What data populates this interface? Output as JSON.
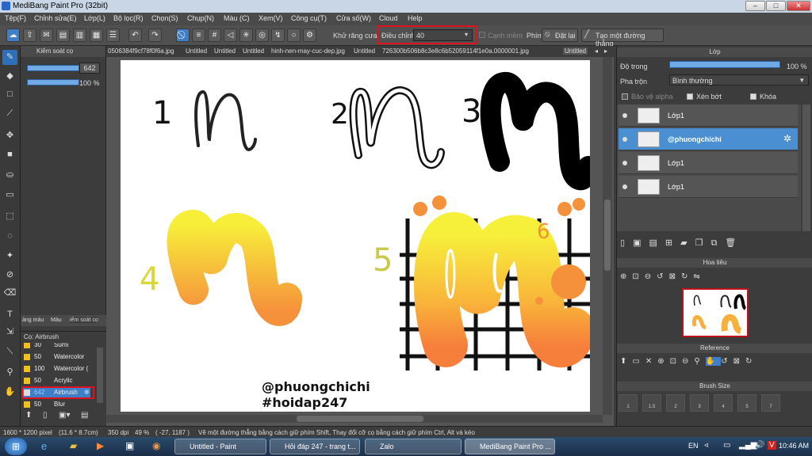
{
  "window": {
    "title": "MediBang Paint Pro (32bit)",
    "btn_min": "‒",
    "btn_max": "□",
    "btn_close": "✕"
  },
  "menu": [
    "Tệp(F)",
    "Chỉnh sửa(E)",
    "Lớp(L)",
    "Bộ lọc(R)",
    "Chọn(S)",
    "Chụp(N)",
    "Màu (C)",
    "Xem(V)",
    "Công cụ(T)",
    "Cửa số(W)",
    "Cloud",
    "Help"
  ],
  "toolbar": {
    "antialias_label": "Khử răng cưa",
    "adjust_label": "Điều chỉnh",
    "adjust_value": "40",
    "edge_label": "Cạnh mềm",
    "key_label": "Phím",
    "reset_label": "Đặt lại",
    "straight_label": "Tạo một đường thẳng"
  },
  "brush_control": {
    "title": "Kiểm soát cọ",
    "size_value": "642",
    "opacity_value": "100 %",
    "size_fraction": 0.62,
    "opacity_fraction": 1.0
  },
  "tabs_left": {
    "a": "ảng màu",
    "b": "Màu",
    "c": "iểm soát cọ"
  },
  "brush_list": {
    "title": "Cọ: Airbrush",
    "items": [
      {
        "size": "30",
        "name": "Sumi",
        "color": "#f0c020"
      },
      {
        "size": "50",
        "name": "Watercolor",
        "color": "#f0c020"
      },
      {
        "size": "100",
        "name": "Watercolor (",
        "color": "#f0c020"
      },
      {
        "size": "50",
        "name": "Acrylic",
        "color": "#f0c020"
      },
      {
        "size": "642",
        "name": "Airbrush",
        "color": "#dddddd"
      },
      {
        "size": "50",
        "name": "Blur",
        "color": "#f0c020"
      }
    ]
  },
  "doc_tabs": [
    "0506384f9cf78f0f6a.jpg",
    "Untitled",
    "Untitled",
    "Untitled",
    "hinh-nen-may-cuc-dep.jpg",
    "Untitled",
    "726300b506b8c3e8c6b52059114f1e0a.0000001.jpg",
    "Untitled"
  ],
  "canvas": {
    "n1": "1",
    "n2": "2",
    "n3": "3",
    "n4": "4",
    "n5": "5",
    "n6": "6",
    "sig1": "@phuongchichi",
    "sig2": "#hoidap247"
  },
  "layers_panel": {
    "title": "Lớp",
    "opacity_label": "Độ trong",
    "opacity_value": "100 %",
    "blend_label": "Pha trộn",
    "blend_value": "Bình thường",
    "protect_alpha": "Bảo vệ alpha",
    "clip": "Xén bớt",
    "lock": "Khóa",
    "layers": [
      {
        "name": "Lớp1"
      },
      {
        "name": "@phuongchichi"
      },
      {
        "name": "Lớp1"
      },
      {
        "name": "Lớp1"
      }
    ]
  },
  "navigator": {
    "title": "Hoa tiêu"
  },
  "reference": {
    "title": "Reference"
  },
  "brush_size": {
    "title": "Brush Size",
    "sizes": [
      "1",
      "1.5",
      "2",
      "3",
      "4",
      "5",
      "7"
    ]
  },
  "status": {
    "dims": "1600 * 1200 pixel",
    "cm": "(11.6 * 8.7cm)",
    "dpi": "350 dpi",
    "zoom": "49 %",
    "coords": "( -27, 1187 )",
    "hint": "Vẽ một đường thẳng bằng cách giữ phím Shift, Thay đổi cỡ cọ bằng cách giữ phím Ctrl, Alt và kéo"
  },
  "taskbar": {
    "tasks": [
      "Untitled - Paint",
      "Hỏi đáp 247 - trang t...",
      "Zalo",
      "MediBang Paint Pro ..."
    ],
    "lang": "EN",
    "time": "10:46 AM"
  }
}
